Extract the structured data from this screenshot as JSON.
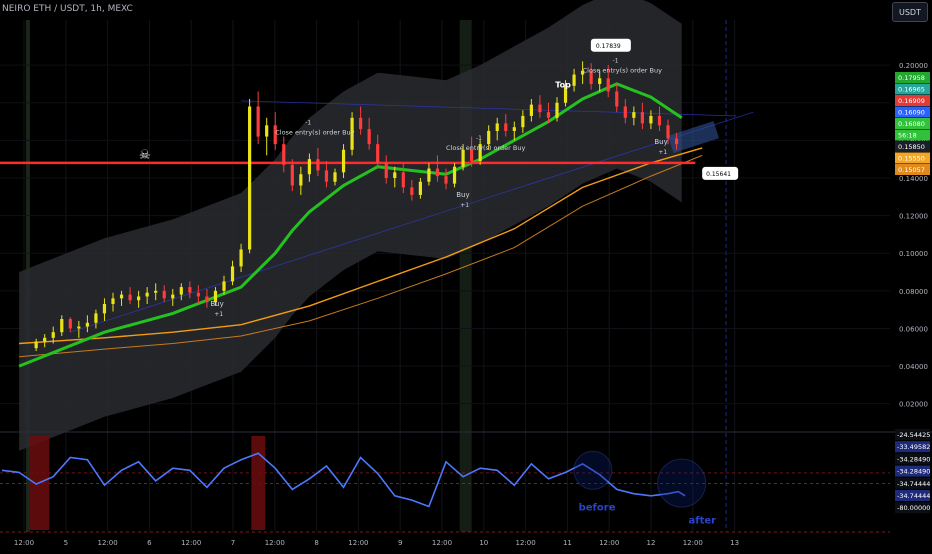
{
  "header": {
    "symbol": "NEIRO ETH / USDT, 1h, MEXC",
    "currency": "USDT"
  },
  "colors": {
    "bg": "#000000",
    "up": "#e9e416",
    "down": "#ff3b3b",
    "ma_fast": "#24c21f",
    "ma_slow": "#f39c12",
    "ma_slow2": "#c47a1d",
    "osc_line": "#4b78ff",
    "hline": "#ff2a2a",
    "trend": "#2d3fd8"
  },
  "chart_data": [
    {
      "type": "candlestick",
      "x_ticks": [
        "12:00",
        "5",
        "12:00",
        "6",
        "12:00",
        "7",
        "12:00",
        "8",
        "12:00",
        "9",
        "12:00",
        "10",
        "12:00",
        "11",
        "12:00",
        "12",
        "12:00",
        "13"
      ],
      "y_ticks": [
        "0.20000",
        "0.18000",
        "0.16000",
        "0.14000",
        "0.12000",
        "0.10000",
        "0.08000",
        "0.06000",
        "0.04000",
        "0.02000"
      ],
      "ylim": [
        0.006,
        0.224
      ],
      "price_labels": [
        "0.17958",
        "0.16965",
        "0.16909",
        "0.16090",
        "0.16080",
        "56:18",
        "0.15850",
        "0.15550",
        "0.15057"
      ],
      "price_label_colors": [
        "#22a82e",
        "#26a69a",
        "#e53935",
        "#2962ff",
        "#31c13a",
        "#31c13a",
        "#1b1f2a",
        "#f5a623",
        "#e08a1e"
      ],
      "annotations": {
        "top": "Top",
        "callout_high": "0.17839",
        "callout_low": "0.15641",
        "close_entry": "Close entry(s) order Buy",
        "buy": "Buy",
        "plus_one": "+1",
        "minus_one": "-1"
      },
      "close_entry_points": [
        {
          "x": 1,
          "y": 0.163
        },
        {
          "x": 6,
          "y": 0.155
        },
        {
          "x": 10,
          "y": 0.196
        }
      ],
      "buy_points": [
        {
          "x": -0.9,
          "y": 0.072
        },
        {
          "x": 6.3,
          "y": 0.13
        },
        {
          "x": 12.1,
          "y": 0.158
        }
      ],
      "horizontal_line": 0.148,
      "candles": [
        {
          "t": -6.0,
          "o": 0.0495,
          "h": 0.0545,
          "l": 0.048,
          "c": 0.053
        },
        {
          "t": -5.75,
          "o": 0.053,
          "h": 0.057,
          "l": 0.05,
          "c": 0.055
        },
        {
          "t": -5.5,
          "o": 0.055,
          "h": 0.061,
          "l": 0.052,
          "c": 0.058
        },
        {
          "t": -5.25,
          "o": 0.058,
          "h": 0.067,
          "l": 0.056,
          "c": 0.065
        },
        {
          "t": -5.0,
          "o": 0.065,
          "h": 0.066,
          "l": 0.058,
          "c": 0.06
        },
        {
          "t": -4.75,
          "o": 0.06,
          "h": 0.064,
          "l": 0.055,
          "c": 0.061
        },
        {
          "t": -4.5,
          "o": 0.061,
          "h": 0.067,
          "l": 0.058,
          "c": 0.063
        },
        {
          "t": -4.25,
          "o": 0.063,
          "h": 0.07,
          "l": 0.06,
          "c": 0.068
        },
        {
          "t": -4.0,
          "o": 0.068,
          "h": 0.076,
          "l": 0.064,
          "c": 0.073
        },
        {
          "t": -3.75,
          "o": 0.073,
          "h": 0.079,
          "l": 0.069,
          "c": 0.076
        },
        {
          "t": -3.5,
          "o": 0.076,
          "h": 0.08,
          "l": 0.072,
          "c": 0.078
        },
        {
          "t": -3.25,
          "o": 0.078,
          "h": 0.082,
          "l": 0.073,
          "c": 0.075
        },
        {
          "t": -3.0,
          "o": 0.075,
          "h": 0.08,
          "l": 0.071,
          "c": 0.077
        },
        {
          "t": -2.75,
          "o": 0.077,
          "h": 0.082,
          "l": 0.073,
          "c": 0.079
        },
        {
          "t": -2.5,
          "o": 0.079,
          "h": 0.084,
          "l": 0.075,
          "c": 0.08
        },
        {
          "t": -2.25,
          "o": 0.08,
          "h": 0.083,
          "l": 0.074,
          "c": 0.076
        },
        {
          "t": -2.0,
          "o": 0.076,
          "h": 0.081,
          "l": 0.072,
          "c": 0.078
        },
        {
          "t": -1.75,
          "o": 0.078,
          "h": 0.084,
          "l": 0.075,
          "c": 0.082
        },
        {
          "t": -1.5,
          "o": 0.082,
          "h": 0.085,
          "l": 0.076,
          "c": 0.079
        },
        {
          "t": -1.25,
          "o": 0.079,
          "h": 0.083,
          "l": 0.073,
          "c": 0.077
        },
        {
          "t": -1.0,
          "o": 0.077,
          "h": 0.081,
          "l": 0.071,
          "c": 0.074
        },
        {
          "t": -0.75,
          "o": 0.074,
          "h": 0.082,
          "l": 0.072,
          "c": 0.08
        },
        {
          "t": -0.5,
          "o": 0.08,
          "h": 0.088,
          "l": 0.078,
          "c": 0.085
        },
        {
          "t": -0.25,
          "o": 0.085,
          "h": 0.096,
          "l": 0.083,
          "c": 0.093
        },
        {
          "t": 0.0,
          "o": 0.093,
          "h": 0.105,
          "l": 0.09,
          "c": 0.102
        },
        {
          "t": 0.25,
          "o": 0.102,
          "h": 0.182,
          "l": 0.1,
          "c": 0.178
        },
        {
          "t": 0.5,
          "o": 0.178,
          "h": 0.186,
          "l": 0.158,
          "c": 0.162
        },
        {
          "t": 0.75,
          "o": 0.162,
          "h": 0.172,
          "l": 0.152,
          "c": 0.168
        },
        {
          "t": 1.0,
          "o": 0.168,
          "h": 0.175,
          "l": 0.155,
          "c": 0.158
        },
        {
          "t": 1.25,
          "o": 0.158,
          "h": 0.162,
          "l": 0.143,
          "c": 0.147
        },
        {
          "t": 1.5,
          "o": 0.147,
          "h": 0.15,
          "l": 0.133,
          "c": 0.136
        },
        {
          "t": 1.75,
          "o": 0.136,
          "h": 0.146,
          "l": 0.131,
          "c": 0.142
        },
        {
          "t": 2.0,
          "o": 0.142,
          "h": 0.153,
          "l": 0.138,
          "c": 0.15
        },
        {
          "t": 2.25,
          "o": 0.15,
          "h": 0.156,
          "l": 0.141,
          "c": 0.144
        },
        {
          "t": 2.5,
          "o": 0.144,
          "h": 0.149,
          "l": 0.135,
          "c": 0.138
        },
        {
          "t": 2.75,
          "o": 0.138,
          "h": 0.145,
          "l": 0.136,
          "c": 0.143
        },
        {
          "t": 3.0,
          "o": 0.143,
          "h": 0.158,
          "l": 0.14,
          "c": 0.155
        },
        {
          "t": 3.25,
          "o": 0.155,
          "h": 0.175,
          "l": 0.152,
          "c": 0.172
        },
        {
          "t": 3.5,
          "o": 0.172,
          "h": 0.178,
          "l": 0.163,
          "c": 0.166
        },
        {
          "t": 3.75,
          "o": 0.166,
          "h": 0.172,
          "l": 0.155,
          "c": 0.158
        },
        {
          "t": 4.0,
          "o": 0.158,
          "h": 0.163,
          "l": 0.145,
          "c": 0.148
        },
        {
          "t": 4.25,
          "o": 0.148,
          "h": 0.152,
          "l": 0.137,
          "c": 0.14
        },
        {
          "t": 4.5,
          "o": 0.14,
          "h": 0.146,
          "l": 0.135,
          "c": 0.143
        },
        {
          "t": 4.75,
          "o": 0.143,
          "h": 0.148,
          "l": 0.132,
          "c": 0.135
        },
        {
          "t": 5.0,
          "o": 0.135,
          "h": 0.139,
          "l": 0.128,
          "c": 0.131
        },
        {
          "t": 5.25,
          "o": 0.131,
          "h": 0.14,
          "l": 0.129,
          "c": 0.138
        },
        {
          "t": 5.5,
          "o": 0.138,
          "h": 0.148,
          "l": 0.136,
          "c": 0.145
        },
        {
          "t": 5.75,
          "o": 0.145,
          "h": 0.152,
          "l": 0.138,
          "c": 0.141
        },
        {
          "t": 6.0,
          "o": 0.141,
          "h": 0.145,
          "l": 0.134,
          "c": 0.137
        },
        {
          "t": 6.25,
          "o": 0.137,
          "h": 0.148,
          "l": 0.135,
          "c": 0.146
        },
        {
          "t": 6.5,
          "o": 0.146,
          "h": 0.158,
          "l": 0.144,
          "c": 0.155
        },
        {
          "t": 6.75,
          "o": 0.155,
          "h": 0.162,
          "l": 0.146,
          "c": 0.149
        },
        {
          "t": 7.0,
          "o": 0.149,
          "h": 0.16,
          "l": 0.147,
          "c": 0.158
        },
        {
          "t": 7.25,
          "o": 0.158,
          "h": 0.168,
          "l": 0.155,
          "c": 0.165
        },
        {
          "t": 7.5,
          "o": 0.165,
          "h": 0.172,
          "l": 0.16,
          "c": 0.169
        },
        {
          "t": 7.75,
          "o": 0.169,
          "h": 0.174,
          "l": 0.162,
          "c": 0.165
        },
        {
          "t": 8.0,
          "o": 0.165,
          "h": 0.17,
          "l": 0.16,
          "c": 0.167
        },
        {
          "t": 8.25,
          "o": 0.167,
          "h": 0.176,
          "l": 0.164,
          "c": 0.173
        },
        {
          "t": 8.5,
          "o": 0.173,
          "h": 0.182,
          "l": 0.17,
          "c": 0.179
        },
        {
          "t": 8.75,
          "o": 0.179,
          "h": 0.184,
          "l": 0.172,
          "c": 0.175
        },
        {
          "t": 9.0,
          "o": 0.175,
          "h": 0.18,
          "l": 0.169,
          "c": 0.172
        },
        {
          "t": 9.25,
          "o": 0.172,
          "h": 0.183,
          "l": 0.17,
          "c": 0.18
        },
        {
          "t": 9.5,
          "o": 0.18,
          "h": 0.192,
          "l": 0.178,
          "c": 0.189
        },
        {
          "t": 9.75,
          "o": 0.189,
          "h": 0.198,
          "l": 0.186,
          "c": 0.195
        },
        {
          "t": 10.0,
          "o": 0.195,
          "h": 0.202,
          "l": 0.19,
          "c": 0.197
        },
        {
          "t": 10.25,
          "o": 0.197,
          "h": 0.201,
          "l": 0.187,
          "c": 0.19
        },
        {
          "t": 10.5,
          "o": 0.19,
          "h": 0.197,
          "l": 0.186,
          "c": 0.193
        },
        {
          "t": 10.75,
          "o": 0.193,
          "h": 0.2,
          "l": 0.183,
          "c": 0.186
        },
        {
          "t": 11.0,
          "o": 0.186,
          "h": 0.19,
          "l": 0.175,
          "c": 0.178
        },
        {
          "t": 11.25,
          "o": 0.178,
          "h": 0.182,
          "l": 0.169,
          "c": 0.172
        },
        {
          "t": 11.5,
          "o": 0.172,
          "h": 0.178,
          "l": 0.168,
          "c": 0.175
        },
        {
          "t": 11.75,
          "o": 0.175,
          "h": 0.18,
          "l": 0.166,
          "c": 0.169
        },
        {
          "t": 12.0,
          "o": 0.169,
          "h": 0.176,
          "l": 0.166,
          "c": 0.173
        },
        {
          "t": 12.25,
          "o": 0.173,
          "h": 0.178,
          "l": 0.165,
          "c": 0.168
        },
        {
          "t": 12.5,
          "o": 0.168,
          "h": 0.171,
          "l": 0.158,
          "c": 0.161
        },
        {
          "t": 12.75,
          "o": 0.161,
          "h": 0.164,
          "l": 0.155,
          "c": 0.158
        }
      ],
      "ma_fast": [
        [
          -6.5,
          0.04
        ],
        [
          -4,
          0.058
        ],
        [
          -2,
          0.068
        ],
        [
          0,
          0.082
        ],
        [
          1,
          0.1
        ],
        [
          1.5,
          0.112
        ],
        [
          2,
          0.122
        ],
        [
          3,
          0.136
        ],
        [
          4,
          0.146
        ],
        [
          5,
          0.144
        ],
        [
          6,
          0.142
        ],
        [
          7,
          0.15
        ],
        [
          8,
          0.16
        ],
        [
          9,
          0.17
        ],
        [
          10,
          0.182
        ],
        [
          11,
          0.19
        ],
        [
          12,
          0.183
        ],
        [
          12.9,
          0.172
        ]
      ],
      "ma_slow": [
        [
          -6.5,
          0.052
        ],
        [
          -4,
          0.055
        ],
        [
          -2,
          0.058
        ],
        [
          0,
          0.062
        ],
        [
          2,
          0.072
        ],
        [
          4,
          0.085
        ],
        [
          6,
          0.098
        ],
        [
          8,
          0.113
        ],
        [
          10,
          0.135
        ],
        [
          12,
          0.148
        ],
        [
          13.5,
          0.156
        ]
      ],
      "ma_slow2": [
        [
          -6.5,
          0.045
        ],
        [
          -4,
          0.049
        ],
        [
          -2,
          0.052
        ],
        [
          0,
          0.056
        ],
        [
          2,
          0.064
        ],
        [
          4,
          0.076
        ],
        [
          6,
          0.089
        ],
        [
          8,
          0.103
        ],
        [
          10,
          0.125
        ],
        [
          12,
          0.141
        ],
        [
          13.5,
          0.152
        ]
      ],
      "oscillator": {
        "ylim": [
          -80,
          14
        ],
        "y_ticks": [
          "-24.54425",
          "-33.49582",
          "-34.28490",
          "-34.28490",
          "-34.74444",
          "-34.74444",
          "-80.00000"
        ],
        "labels": {
          "before": "before",
          "after": "after"
        },
        "series": [
          [
            -7,
            -22
          ],
          [
            -6.5,
            -24
          ],
          [
            -6,
            -35
          ],
          [
            -5.5,
            -28
          ],
          [
            -5,
            -10
          ],
          [
            -4.5,
            -12
          ],
          [
            -4,
            -36
          ],
          [
            -3.5,
            -22
          ],
          [
            -3,
            -14
          ],
          [
            -2.5,
            -32
          ],
          [
            -2,
            -20
          ],
          [
            -1.5,
            -22
          ],
          [
            -1,
            -38
          ],
          [
            -0.5,
            -20
          ],
          [
            0,
            -12
          ],
          [
            0.5,
            -6
          ],
          [
            1,
            -20
          ],
          [
            1.5,
            -40
          ],
          [
            2,
            -30
          ],
          [
            2.5,
            -18
          ],
          [
            3,
            -38
          ],
          [
            3.5,
            -10
          ],
          [
            4,
            -25
          ],
          [
            4.5,
            -46
          ],
          [
            5,
            -50
          ],
          [
            5.5,
            -56
          ],
          [
            6,
            -14
          ],
          [
            6.5,
            -28
          ],
          [
            7,
            -20
          ],
          [
            7.5,
            -22
          ],
          [
            8,
            -36
          ],
          [
            8.5,
            -16
          ],
          [
            9,
            -30
          ],
          [
            9.5,
            -24
          ],
          [
            10,
            -16
          ],
          [
            10.5,
            -26
          ],
          [
            11,
            -40
          ],
          [
            11.5,
            -44
          ],
          [
            12,
            -46
          ],
          [
            12.5,
            -44
          ],
          [
            12.8,
            -42
          ],
          [
            13,
            -46
          ]
        ]
      }
    }
  ]
}
